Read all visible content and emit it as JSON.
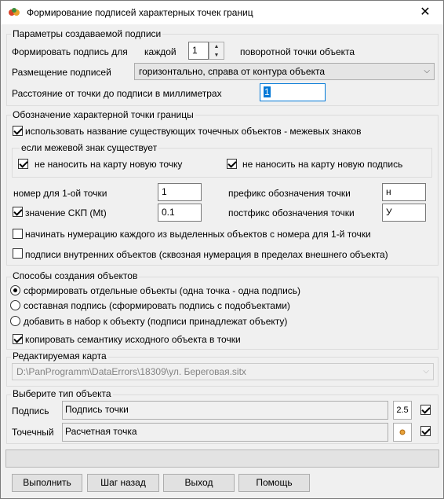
{
  "window": {
    "title": "Формирование подписей характерных точек границ",
    "close_icon": "close-icon",
    "app_icon": "app-icon"
  },
  "params": {
    "legend": "Параметры создаваемой подписи",
    "form_label": "Формировать подпись для",
    "each_label": "каждой",
    "each_value": "1",
    "vertex_label": "поворотной точки объекта",
    "placement_label": "Размещение подписей",
    "placement_value": "горизонтально, справа от контура объекта",
    "distance_label": "Расстояние от точки до подписи в миллиметрах",
    "distance_value": "1"
  },
  "designation": {
    "legend": "Обозначение характерной точки границы",
    "use_existing_label": "использовать название существующих точечных объектов - межевых знаков",
    "use_existing_checked": true,
    "if_exists_legend": "если межевой знак существует",
    "no_new_point_label": "не наносить на карту новую точку",
    "no_new_point_checked": true,
    "no_new_label_label": "не наносить на карту новую подпись",
    "no_new_label_checked": true,
    "first_number_label": "номер для 1-ой точки",
    "first_number_value": "1",
    "prefix_label": "префикс обозначения точки",
    "prefix_value": "н",
    "skp_label": "значение СКП (Mt)",
    "skp_checked": true,
    "skp_value": "0.1",
    "postfix_label": "постфикс обозначения точки",
    "postfix_value": "У",
    "numbering_label": "начинать нумерацию каждого из выделенных объектов с номера для 1-й точки",
    "numbering_checked": false,
    "inner_label": "подписи внутренних объектов (сквозная нумерация в пределах  внешнего объекта)",
    "inner_checked": false
  },
  "creation": {
    "legend": "Способы создания объектов",
    "options": [
      {
        "label": "сформировать отдельные объекты (одна точка - одна подпись)",
        "selected": true
      },
      {
        "label": "составная подпись (сформировать подпись с подобъектами)",
        "selected": false
      },
      {
        "label": "добавить в набор к объекту (подписи принадлежат объекту)",
        "selected": false
      }
    ],
    "copy_semantics_label": "копировать семантику исходного объекта в точки",
    "copy_semantics_checked": true
  },
  "map": {
    "legend": "Редактируемая карта",
    "path": "D:\\PanProgramm\\DataErrors\\18309\\ул. Береговая.sitx"
  },
  "object_type": {
    "legend": "Выберите тип объекта",
    "label_row": {
      "label": "Подпись",
      "value": "Подпись точки",
      "size": "2.5",
      "checked": true
    },
    "point_row": {
      "label": "Точечный",
      "value": "Расчетная точка",
      "checked": true
    }
  },
  "buttons": {
    "run": "Выполнить",
    "step_back": "Шаг назад",
    "exit": "Выход",
    "help": "Помощь"
  }
}
